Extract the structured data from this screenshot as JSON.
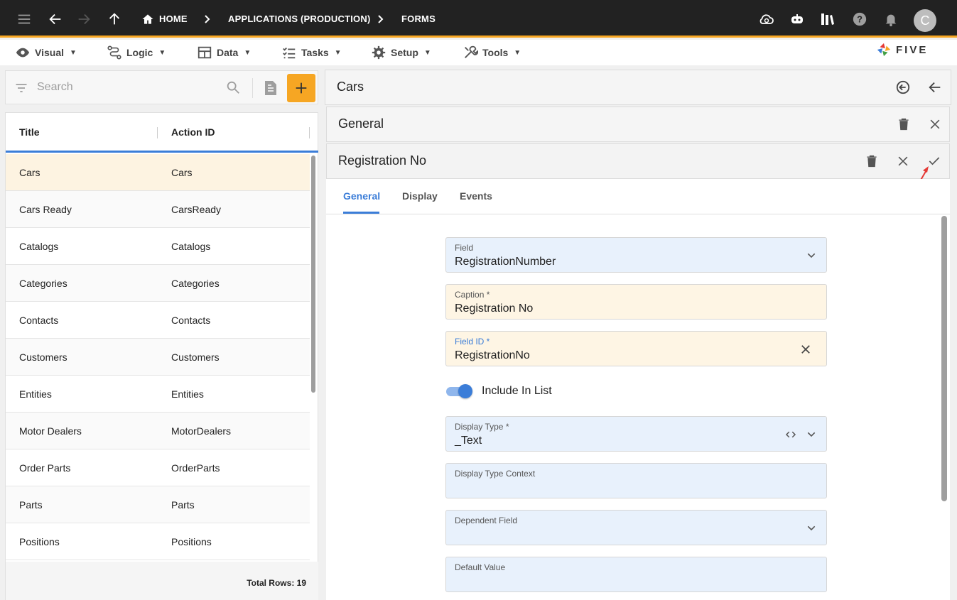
{
  "topbar": {
    "breadcrumbs": [
      "HOME",
      "APPLICATIONS (PRODUCTION)",
      "FORMS"
    ],
    "avatar_initial": "C",
    "icons": [
      "menu-icon",
      "back-arrow-icon",
      "forward-arrow-icon",
      "up-arrow-icon",
      "home-icon",
      "cloud-icon",
      "chatbot-icon",
      "library-icon",
      "help-icon",
      "bell-icon"
    ]
  },
  "menubar": {
    "items": [
      {
        "label": "Visual",
        "icon": "eye-icon"
      },
      {
        "label": "Logic",
        "icon": "logic-icon"
      },
      {
        "label": "Data",
        "icon": "table-icon"
      },
      {
        "label": "Tasks",
        "icon": "checklist-icon"
      },
      {
        "label": "Setup",
        "icon": "gear-icon"
      },
      {
        "label": "Tools",
        "icon": "tools-icon"
      }
    ],
    "logo_text": "FIVE"
  },
  "search": {
    "placeholder": "Search"
  },
  "list": {
    "columns": [
      "Title",
      "Action ID"
    ],
    "rows": [
      {
        "title": "Cars",
        "action_id": "Cars"
      },
      {
        "title": "Cars Ready",
        "action_id": "CarsReady"
      },
      {
        "title": "Catalogs",
        "action_id": "Catalogs"
      },
      {
        "title": "Categories",
        "action_id": "Categories"
      },
      {
        "title": "Contacts",
        "action_id": "Contacts"
      },
      {
        "title": "Customers",
        "action_id": "Customers"
      },
      {
        "title": "Entities",
        "action_id": "Entities"
      },
      {
        "title": "Motor Dealers",
        "action_id": "MotorDealers"
      },
      {
        "title": "Order Parts",
        "action_id": "OrderParts"
      },
      {
        "title": "Parts",
        "action_id": "Parts"
      },
      {
        "title": "Positions",
        "action_id": "Positions"
      }
    ],
    "total_rows": "Total Rows: 19"
  },
  "panels": {
    "level1_title": "Cars",
    "level2_title": "General",
    "level3_title": "Registration No"
  },
  "tabs": [
    "General",
    "Display",
    "Events"
  ],
  "form": {
    "field": {
      "label": "Field",
      "value": "RegistrationNumber"
    },
    "caption": {
      "label": "Caption *",
      "value": "Registration No"
    },
    "field_id": {
      "label": "Field ID *",
      "value": "RegistrationNo"
    },
    "include_in_list": {
      "label": "Include In List",
      "checked": true
    },
    "display_type": {
      "label": "Display Type *",
      "value": "_Text"
    },
    "display_type_context": {
      "label": "Display Type Context",
      "value": ""
    },
    "dependent_field": {
      "label": "Dependent Field",
      "value": ""
    },
    "default_value": {
      "label": "Default Value",
      "value": ""
    }
  },
  "colors": {
    "accent": "#f6a623",
    "primary": "#3b7dd8",
    "topbar": "#222222"
  }
}
